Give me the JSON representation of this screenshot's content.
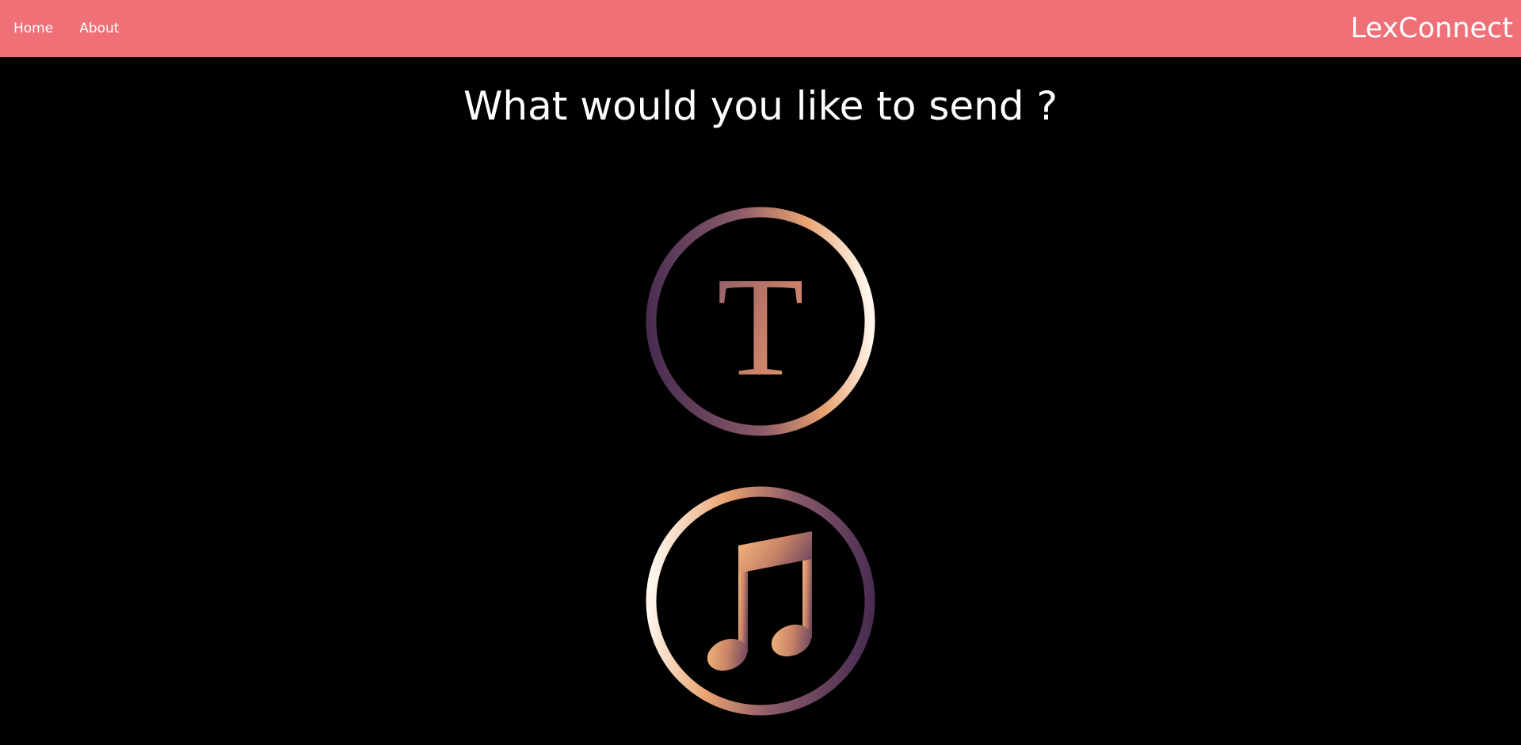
{
  "nav": {
    "links": [
      {
        "label": "Home"
      },
      {
        "label": "About"
      }
    ],
    "brand": "LexConnect"
  },
  "main": {
    "title": "What would you like to send ?",
    "options": [
      {
        "icon": "text-icon",
        "letter": "T"
      },
      {
        "icon": "music-note-icon"
      }
    ]
  },
  "colors": {
    "navbar": "#f07077",
    "background": "#000000",
    "gradient_purple": "#4a2e52",
    "gradient_orange": "#e9a270",
    "gradient_cream": "#fff6ec"
  }
}
